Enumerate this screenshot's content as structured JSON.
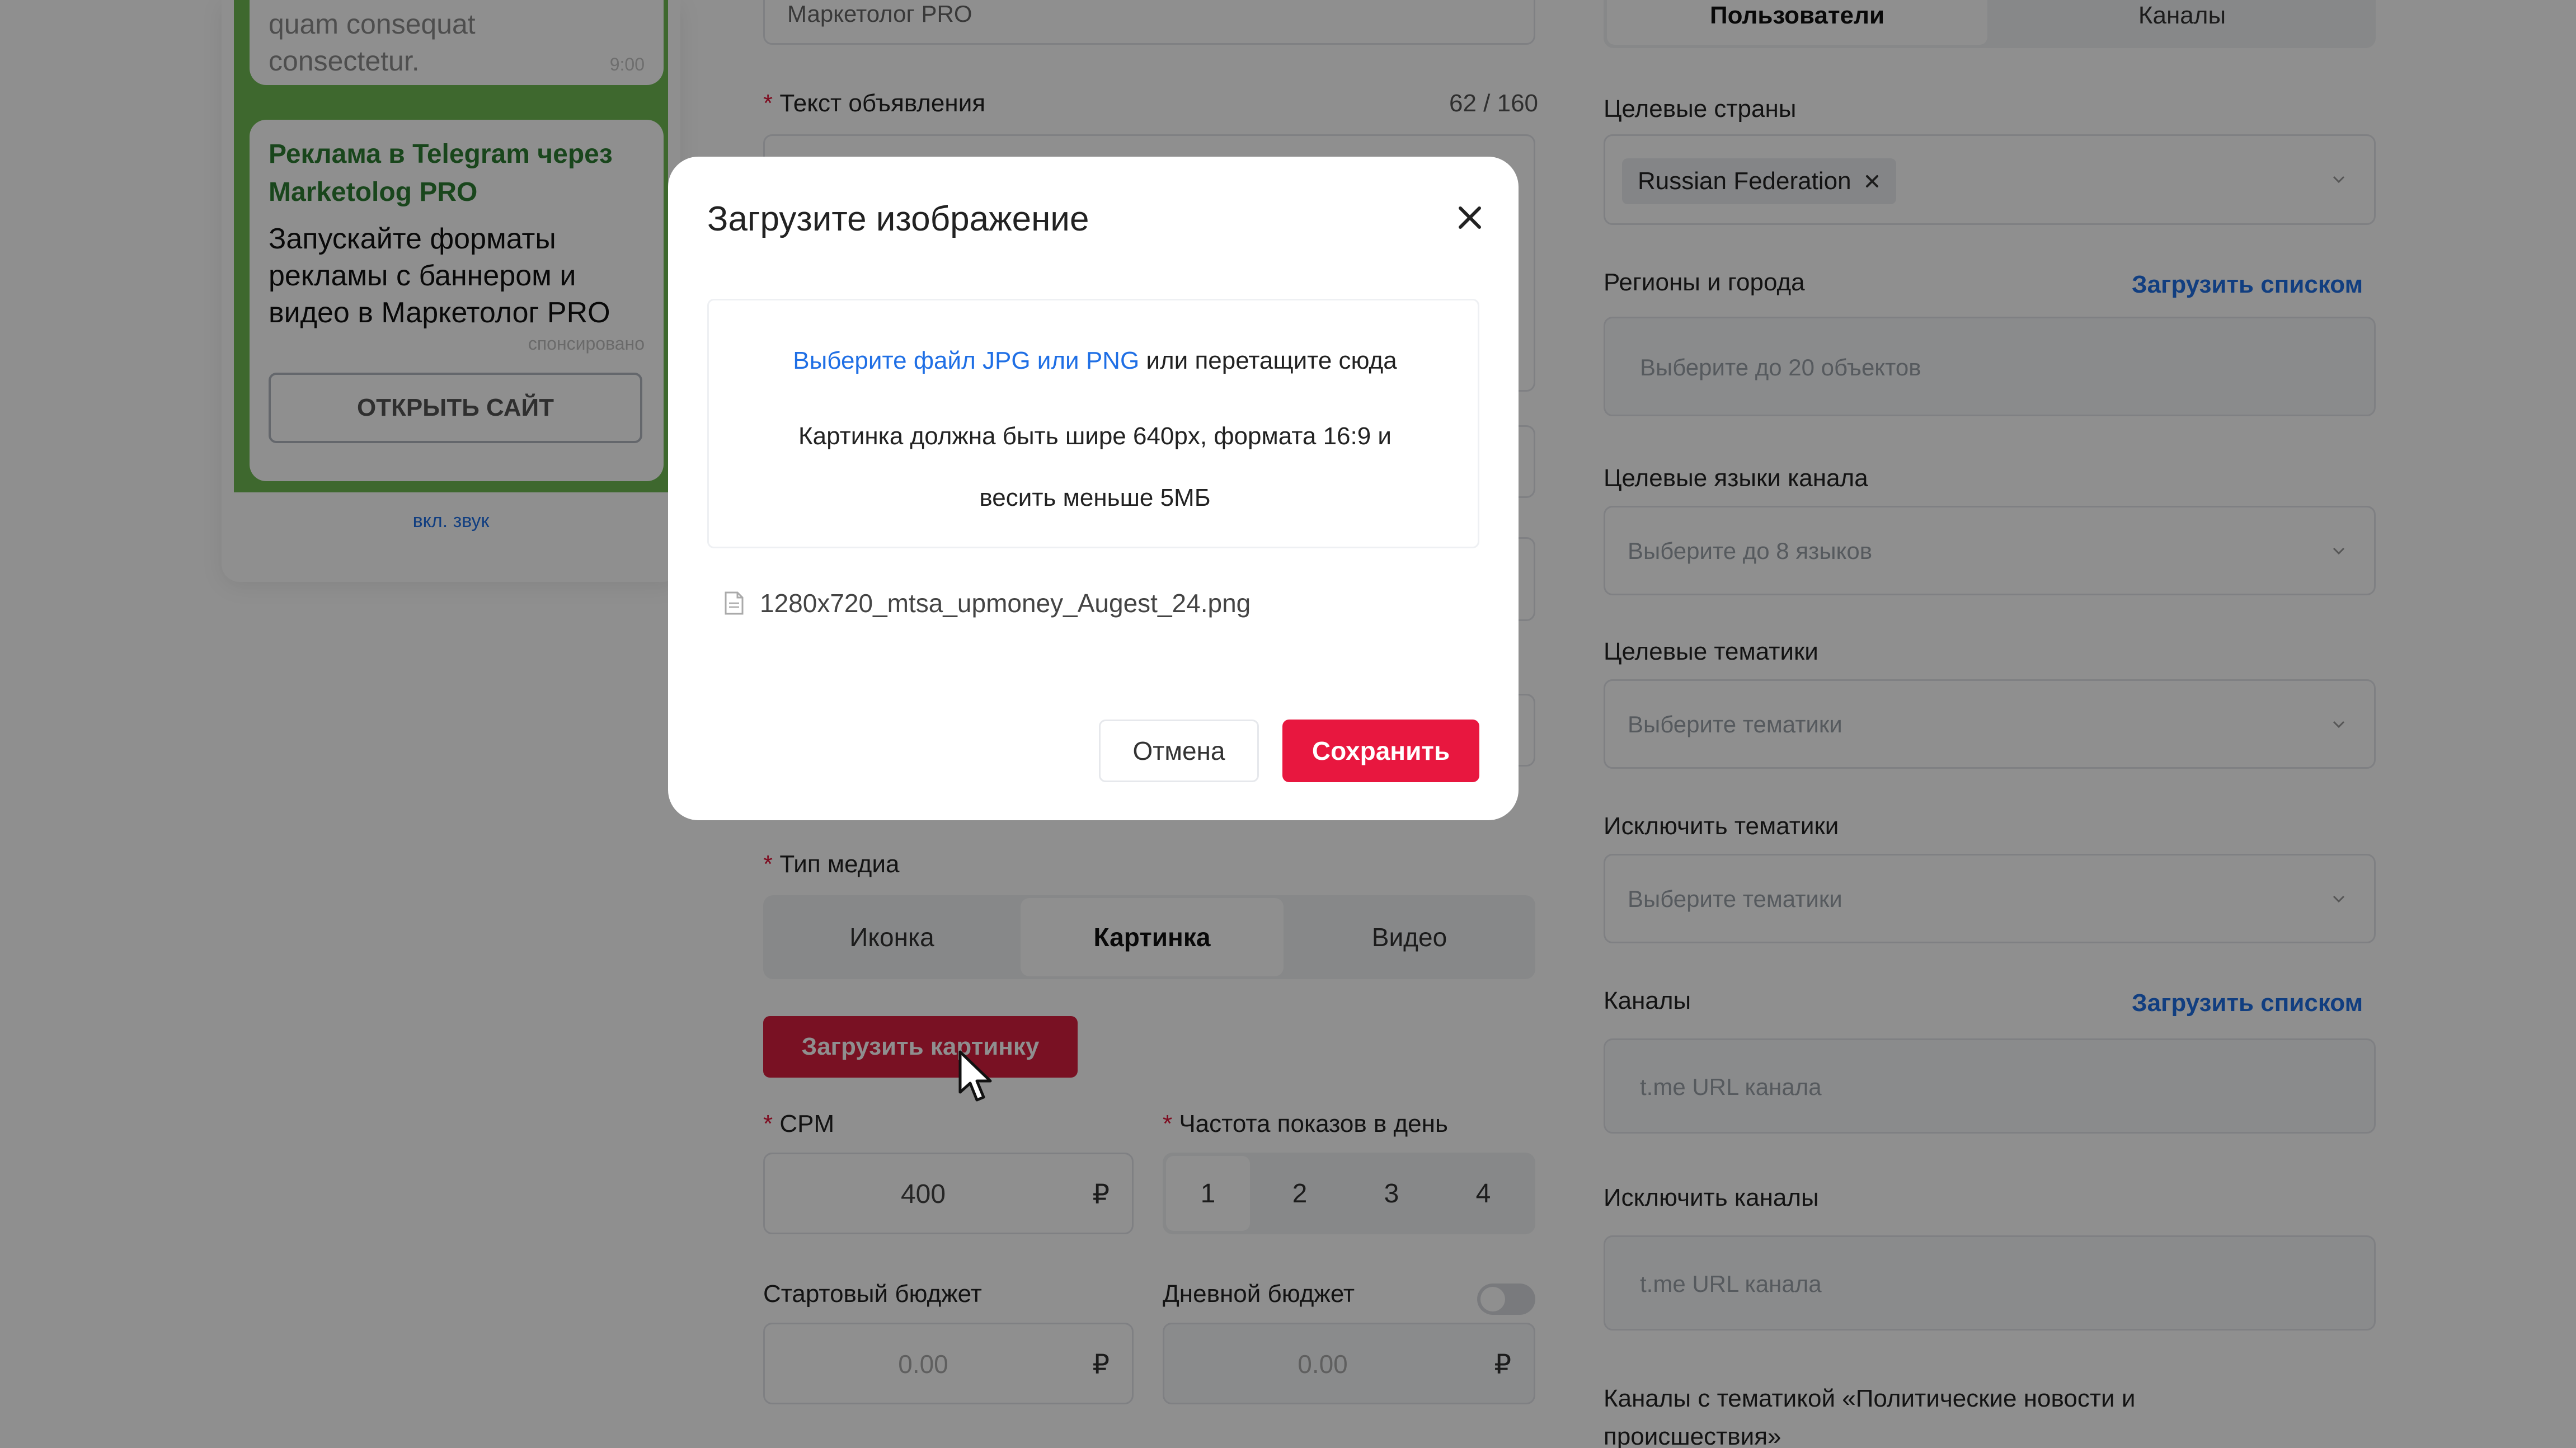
{
  "preview": {
    "top_text_line1": "quam consequat",
    "top_text_line2": "consectetur.",
    "top_time": "9:00",
    "ad_title_line1": "Реклама в Telegram через",
    "ad_title_line2": "Marketolog PRO",
    "ad_body_line1": "Запускайте форматы",
    "ad_body_line2": "рекламы с баннером и",
    "ad_body_line3": "видео в Маркетолог PRO",
    "sponsored": "спонсировано",
    "open_site_button": "ОТКРЫТЬ САЙТ",
    "sound_link": "вкл. звук"
  },
  "form": {
    "top_field_value": "Маркетолог PRO",
    "ad_text_label": "Текст объявления",
    "ad_text_counter": "62 / 160",
    "media_type_label": "Тип медиа",
    "media_types": [
      "Иконка",
      "Картинка",
      "Видео"
    ],
    "media_selected": "Картинка",
    "upload_button": "Загрузить картинку",
    "cpm_label": "CPM",
    "cpm_value": "400",
    "currency": "₽",
    "frequency_label": "Частота показов в день",
    "frequency_options": [
      "1",
      "2",
      "3",
      "4"
    ],
    "frequency_selected": "1",
    "start_budget_label": "Стартовый бюджет",
    "start_budget_value": "0.00",
    "daily_budget_label": "Дневной бюджет",
    "daily_budget_value": "0.00",
    "daily_budget_toggle_on": false
  },
  "targeting": {
    "tabs": [
      "Пользователи",
      "Каналы"
    ],
    "active_tab": "Пользователи",
    "countries_label": "Целевые страны",
    "country_tag": "Russian Federation",
    "regions_label": "Регионы и города",
    "load_list_link": "Загрузить списком",
    "regions_placeholder": "Выберите до 20 объектов",
    "languages_label": "Целевые языки канала",
    "languages_placeholder": "Выберите до 8 языков",
    "topics_label": "Целевые тематики",
    "topics_placeholder": "Выберите тематики",
    "exclude_topics_label": "Исключить тематики",
    "exclude_topics_placeholder": "Выберите тематики",
    "channels_label": "Каналы",
    "channels_placeholder": "t.me URL канала",
    "exclude_channels_label": "Исключить каналы",
    "exclude_channels_placeholder": "t.me URL канала",
    "political_line1": "Каналы с тематикой «Политические новости и",
    "political_line2": "происшествия»"
  },
  "modal": {
    "title": "Загрузите изображение",
    "choose_file_link": "Выберите файл JPG или PNG",
    "drop_hint": "или перетащите сюда",
    "requirements_line1": "Картинка должна быть шире 640px, формата 16:9 и",
    "requirements_line2": "весить меньше 5МБ",
    "file_name": "1280x720_mtsa_upmoney_Augest_24.png",
    "cancel_button": "Отмена",
    "save_button": "Сохранить"
  },
  "colors": {
    "accent_red": "#e8173f",
    "upload_red": "#d81f3f",
    "link_blue": "#1f6fe5",
    "preview_green": "#6fba53",
    "ad_title_green": "#2e7d32"
  },
  "icons": {
    "close": "close-icon",
    "file": "file-icon",
    "chevron": "chevron-down-icon",
    "tag_remove": "tag-remove-icon",
    "cursor": "mouse-pointer-icon"
  }
}
